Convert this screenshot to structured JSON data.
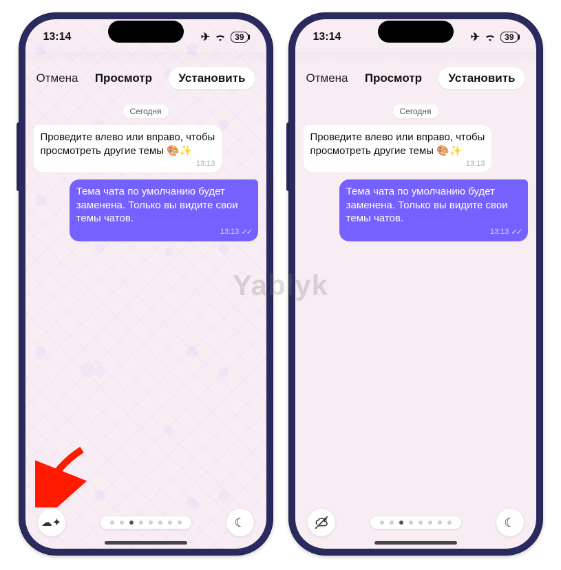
{
  "watermark": "Yablyk",
  "status": {
    "time": "13:14",
    "battery": "39"
  },
  "header": {
    "cancel": "Отмена",
    "title": "Просмотр",
    "install": "Установить"
  },
  "chat": {
    "date_label": "Сегодня",
    "incoming": {
      "text": "Проведите влево или вправо, чтобы просмотреть другие темы 🎨✨",
      "time": "13:13"
    },
    "outgoing": {
      "text": "Тема чата по умолчанию будет заменена. Только вы видите свои темы чатов.",
      "time": "13:13"
    }
  },
  "icons": {
    "airplane": "✈︎",
    "moon": "☾",
    "doodle_toggle_on": "☁✦",
    "doodle_toggle_off": "⊘",
    "checks": "✓✓"
  },
  "pager": {
    "total": 8,
    "active_index": 2
  }
}
